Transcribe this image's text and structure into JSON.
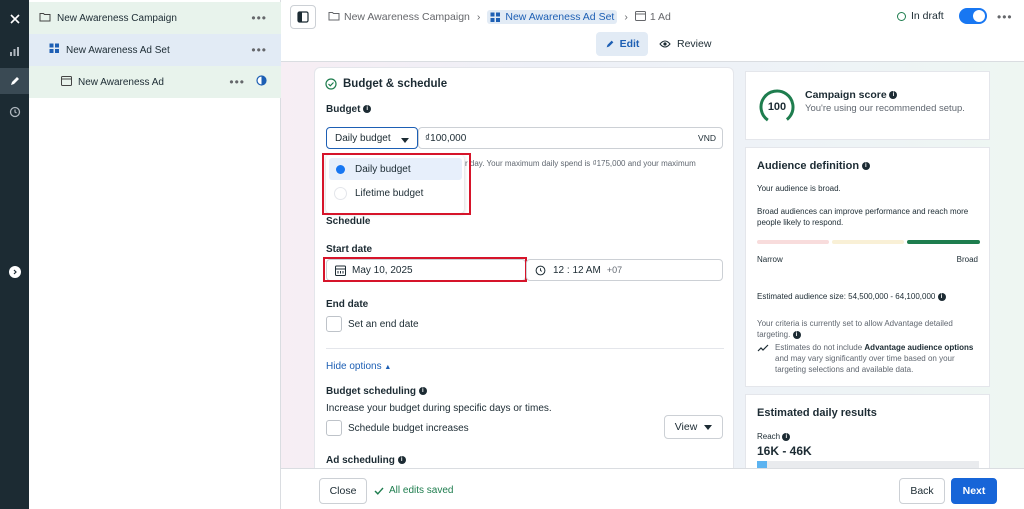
{
  "rail": {
    "close_icon": "close-icon",
    "items": [
      "chart-icon",
      "pencil-icon",
      "clock-icon"
    ]
  },
  "tree": {
    "campaign": "New Awareness Campaign",
    "adset": "New Awareness Ad Set",
    "ad": "New Awareness Ad"
  },
  "header": {
    "crumb_campaign": "New Awareness Campaign",
    "crumb_adset": "New Awareness Ad Set",
    "crumb_ad": "1 Ad",
    "status": "In draft",
    "tab_edit": "Edit",
    "tab_review": "Review"
  },
  "budget": {
    "section_title": "Budget & schedule",
    "budget_label": "Budget",
    "budget_type": "Daily budget",
    "amount": "₫100,000",
    "currency": "VND",
    "helper_text": "r day. Your maximum daily spend is ₫175,000 and your maximum",
    "options": [
      "Daily budget",
      "Lifetime budget"
    ],
    "schedule_label": "Schedule",
    "start_date_label": "Start date",
    "start_date": "May 10, 2025",
    "start_time": "12 : 12 AM",
    "timezone": "+07",
    "end_date_label": "End date",
    "end_date_checkbox": "Set an end date",
    "hide_options": "Hide options",
    "budget_scheduling_label": "Budget scheduling",
    "budget_scheduling_desc": "Increase your budget during specific days or times.",
    "schedule_increases": "Schedule budget increases",
    "view_button": "View",
    "ad_scheduling_label": "Ad scheduling"
  },
  "score": {
    "value": "100",
    "title": "Campaign score",
    "desc": "You're using our recommended setup."
  },
  "audience": {
    "title": "Audience definition",
    "broad_text": "Your audience is broad.",
    "broad_desc": "Broad audiences can improve performance and reach more people likely to respond.",
    "narrow": "Narrow",
    "broad": "Broad",
    "size": "Estimated audience size: 54,500,000 - 64,100,000",
    "criteria": "Your criteria is currently set to allow Advantage detailed targeting.",
    "estimate_note_bold": "Advantage audience options",
    "estimate_note_pre": "Estimates do not include",
    "estimate_note_post": "and may vary significantly over time based on your targeting selections and available data."
  },
  "results": {
    "title": "Estimated daily results",
    "reach_label": "Reach",
    "reach_value": "16K - 46K"
  },
  "footer": {
    "close": "Close",
    "saved": "All edits saved",
    "back": "Back",
    "next": "Next"
  },
  "colors": {
    "accent": "#1877f2",
    "green": "#1e7d4e",
    "dark": "#1c2b33"
  }
}
